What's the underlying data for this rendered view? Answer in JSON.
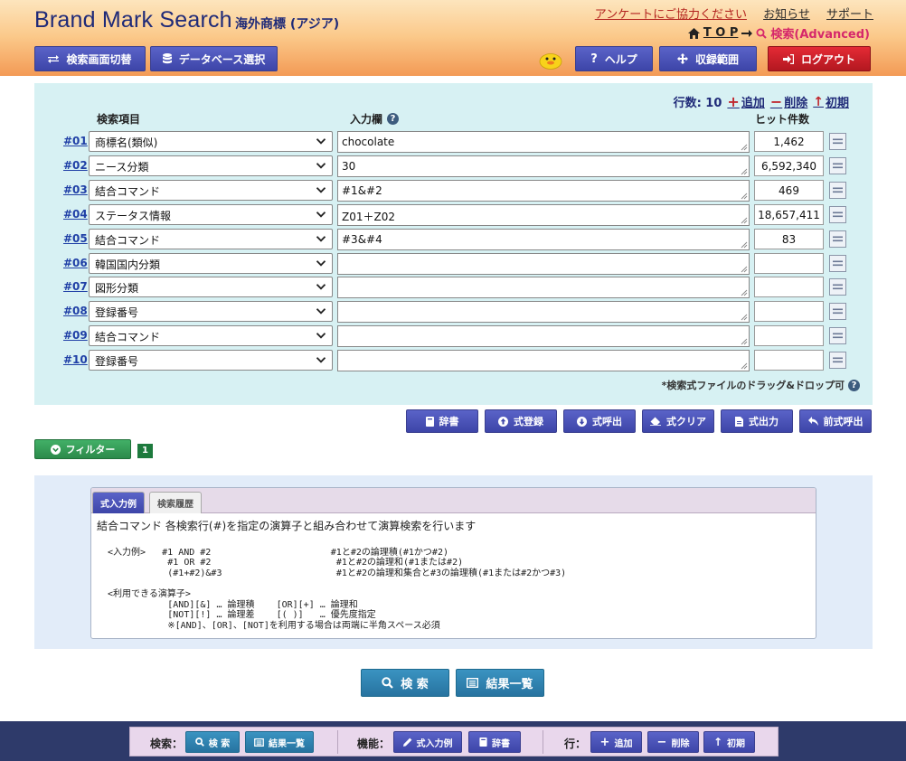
{
  "header": {
    "brand": "Brand Mark Search",
    "subbrand": "海外商標 (アジア)",
    "links": [
      "アンケートにご協力ください",
      "お知らせ",
      "サポート"
    ],
    "crumb_top": "T O P",
    "crumb_current": "検索(Advanced)",
    "buttons": {
      "switch": "検索画面切替",
      "database": "データベース選択",
      "help": "ヘルプ",
      "coverage": "収録範囲",
      "logout": "ログアウト"
    }
  },
  "panel": {
    "row_count_label": "行数: 10",
    "add": "追加",
    "delete": "削除",
    "reset": "初期",
    "col_item": "検索項目",
    "col_input": "入力欄",
    "col_hits": "ヒット件数",
    "rows": [
      {
        "num": "#01",
        "field": "商標名(類似)",
        "value": "chocolate",
        "hits": "1,462"
      },
      {
        "num": "#02",
        "field": "ニース分類",
        "value": "30",
        "hits": "6,592,340"
      },
      {
        "num": "#03",
        "field": "結合コマンド",
        "value": "#1&#2",
        "hits": "469"
      },
      {
        "num": "#04",
        "field": "ステータス情報",
        "value": "Z01＋Z02",
        "hits": "18,657,411"
      },
      {
        "num": "#05",
        "field": "結合コマンド",
        "value": "#3&#4",
        "hits": "83"
      },
      {
        "num": "#06",
        "field": "韓国国内分類",
        "value": "",
        "hits": ""
      },
      {
        "num": "#07",
        "field": "図形分類",
        "value": "",
        "hits": ""
      },
      {
        "num": "#08",
        "field": "登録番号",
        "value": "",
        "hits": ""
      },
      {
        "num": "#09",
        "field": "結合コマンド",
        "value": "",
        "hits": ""
      },
      {
        "num": "#10",
        "field": "登録番号",
        "value": "",
        "hits": ""
      }
    ],
    "drop_note": "*検索式ファイルのドラッグ&ドロップ可"
  },
  "actions": {
    "dictionary": "辞書",
    "register": "式登録",
    "recall": "式呼出",
    "clear": "式クリア",
    "output": "式出力",
    "previous": "前式呼出"
  },
  "filter": {
    "label": "フィルター",
    "count": "1"
  },
  "help": {
    "tab_active": "式入力例",
    "tab_inactive": "検索履歴",
    "lead": "結合コマンド  各検索行(#)を指定の演算子と組み合わせて演算検索を行います",
    "body": "\n  <入力例>   #1 AND #2                      #1と#2の論理積(#1かつ#2)\n             #1 OR #2                       #1と#2の論理和(#1または#2)\n             (#1+#2)&#3                     #1と#2の論理和集合と#3の論理積(#1または#2かつ#3)\n\n  <利用できる演算子>\n             [AND][&] … 論理積    [OR][+] … 論理和\n             [NOT][!] … 論理差    [( )]   … 優先度指定\n             ※[AND]、[OR]、[NOT]を利用する場合は両端に半角スペース必須"
  },
  "main": {
    "search": "検 索",
    "results": "結果一覧"
  },
  "footer": {
    "search_group": "検索：",
    "search": "検 索",
    "results": "結果一覧",
    "function_group": "機能：",
    "input_example": "式入力例",
    "dictionary": "辞書",
    "row_group": "行：",
    "add": "追加",
    "delete": "削除",
    "reset": "初期"
  }
}
